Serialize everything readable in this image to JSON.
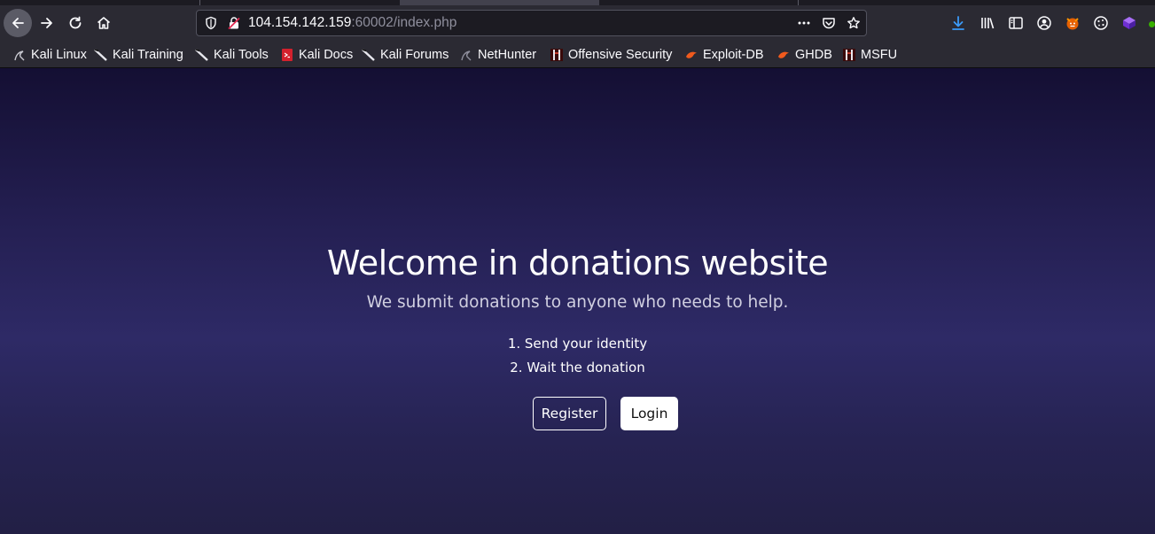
{
  "browser": {
    "url": {
      "host": "104.154.142.159",
      "rest": ":60002/index.php"
    },
    "toolbar_icons": [
      "back-icon",
      "forward-icon",
      "reload-icon",
      "home-icon",
      "shield-icon",
      "insecure-lock-icon",
      "page-actions-icon",
      "pocket-icon",
      "bookmark-star-icon",
      "download-icon",
      "library-icon",
      "sidebar-icon",
      "account-icon",
      "extension-fox-icon",
      "cookie-icon",
      "extension-cube-icon"
    ],
    "accent_color": "#3b9af8",
    "bookmarks": [
      {
        "label": "Kali Linux",
        "icon": "kali-dragon-icon"
      },
      {
        "label": "Kali Training",
        "icon": "kali-sword-icon"
      },
      {
        "label": "Kali Tools",
        "icon": "kali-sword-icon"
      },
      {
        "label": "Kali Docs",
        "icon": "kali-docs-icon"
      },
      {
        "label": "Kali Forums",
        "icon": "kali-sword-icon"
      },
      {
        "label": "NetHunter",
        "icon": "kali-dragon-icon"
      },
      {
        "label": "Offensive Security",
        "icon": "offsec-icon"
      },
      {
        "label": "Exploit-DB",
        "icon": "exploitdb-icon"
      },
      {
        "label": "GHDB",
        "icon": "exploitdb-icon"
      },
      {
        "label": "MSFU",
        "icon": "offsec-icon"
      }
    ]
  },
  "page": {
    "title": "Welcome in donations website",
    "subtitle": "We submit donations to anyone who needs to help.",
    "steps": [
      "1. Send your identity",
      "2. Wait the donation"
    ],
    "buttons": {
      "register": "Register",
      "login": "Login"
    },
    "background_colors": [
      "#140f33",
      "#2e2a66",
      "#221f45"
    ]
  }
}
